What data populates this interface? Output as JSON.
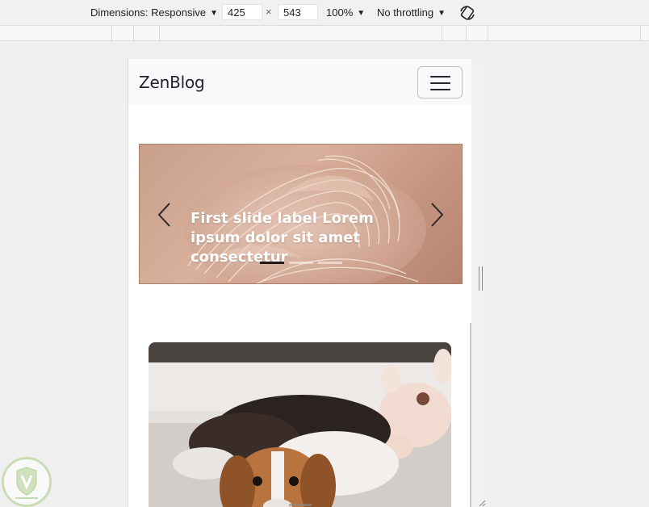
{
  "devtools": {
    "dimensions_label": "Dimensions: Responsive",
    "width": "425",
    "height": "543",
    "times": "×",
    "zoom": "100%",
    "throttling": "No throttling",
    "caret": "▼"
  },
  "navbar": {
    "brand": "ZenBlog"
  },
  "carousel": {
    "caption": "First slide label Lorem ipsum dolor sit amet consectetur",
    "slide_count": 3,
    "active_index": 0
  }
}
